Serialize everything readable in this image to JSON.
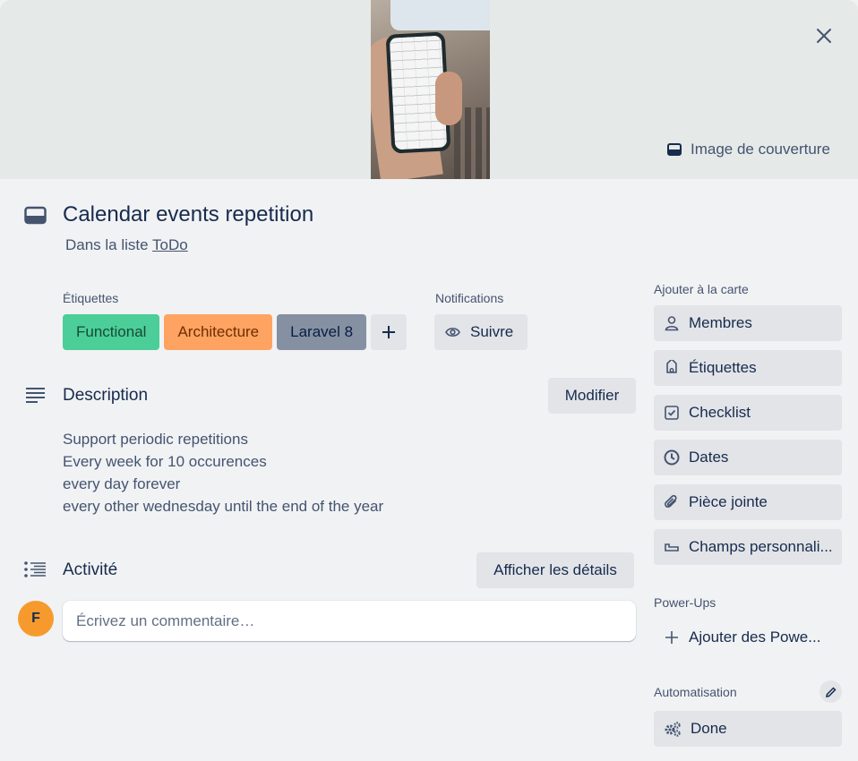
{
  "cover": {
    "button_label": "Image de couverture"
  },
  "card": {
    "title": "Calendar events repetition",
    "list_prefix": "Dans la liste",
    "list_name": "ToDo"
  },
  "labels_section": {
    "heading": "Étiquettes",
    "items": [
      {
        "text": "Functional",
        "color": "#4bce97",
        "text_color": "#164b35"
      },
      {
        "text": "Architecture",
        "color": "#fea362",
        "text_color": "#702e00"
      },
      {
        "text": "Laravel 8",
        "color": "#8590a2",
        "text_color": "#091e42"
      }
    ]
  },
  "notifications": {
    "heading": "Notifications",
    "follow_label": "Suivre"
  },
  "description": {
    "heading": "Description",
    "edit_label": "Modifier",
    "lines": [
      "Support periodic repetitions",
      "Every week for 10 occurences",
      "every day forever",
      "every other wednesday until the end of the year"
    ]
  },
  "activity": {
    "heading": "Activité",
    "details_label": "Afficher les détails",
    "avatar_initial": "F",
    "comment_placeholder": "Écrivez un commentaire…"
  },
  "sidebar": {
    "add_heading": "Ajouter à la carte",
    "add_items": [
      "Membres",
      "Étiquettes",
      "Checklist",
      "Dates",
      "Pièce jointe",
      "Champs personnali..."
    ],
    "powerups_heading": "Power-Ups",
    "powerups_add": "Ajouter des Powe...",
    "automation_heading": "Automatisation",
    "automation_items": [
      "Done"
    ]
  }
}
